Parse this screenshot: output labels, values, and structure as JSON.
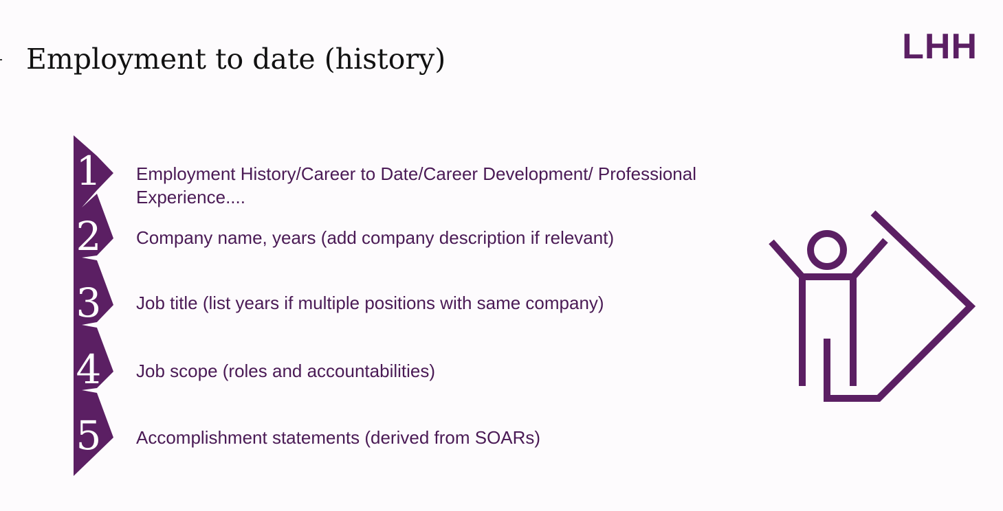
{
  "slide": {
    "title": "Employment to date (history)",
    "logo_text": "LHH"
  },
  "colors": {
    "brand_purple": "#5b1f63",
    "text_purple": "#4a1a55",
    "title_text": "#111111",
    "background": "#fdfbfd"
  },
  "steps": [
    {
      "number": "1",
      "text": "Employment History/Career to Date/Career Development/ Professional Experience...."
    },
    {
      "number": "2",
      "text": "Company name, years (add company description if relevant)"
    },
    {
      "number": "3",
      "text": "Job title (list years if multiple positions with same company)"
    },
    {
      "number": "4",
      "text": "Job scope (roles and accountabilities)"
    },
    {
      "number": "5",
      "text": "Accomplishment statements (derived from SOARs)"
    }
  ],
  "illustration": {
    "icon": "person-arrow-icon"
  }
}
